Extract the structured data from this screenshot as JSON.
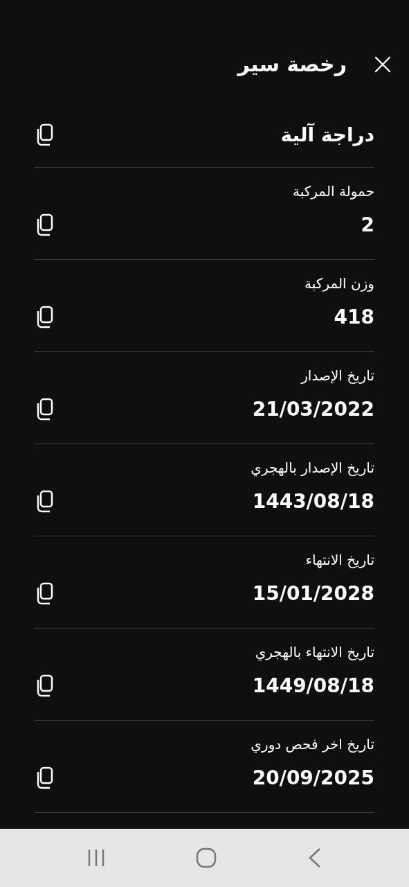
{
  "header": {
    "title": "رخصة سير",
    "close": "×"
  },
  "fields": [
    {
      "value": "دراجة آلية"
    },
    {
      "label": "حمولة المركبة",
      "value": "2"
    },
    {
      "label": "وزن المركبة",
      "value": "418"
    },
    {
      "label": "تاريخ الإصدار",
      "value": "21/03/2022"
    },
    {
      "label": "تاريخ الإصدار بالهجري",
      "value": "1443/08/18"
    },
    {
      "label": "تاريخ الانتهاء",
      "value": "15/01/2028"
    },
    {
      "label": "تاريخ الانتهاء بالهجري",
      "value": "1449/08/18"
    },
    {
      "label": "تاريخ اخر فحص دوري",
      "value": "20/09/2025"
    }
  ]
}
